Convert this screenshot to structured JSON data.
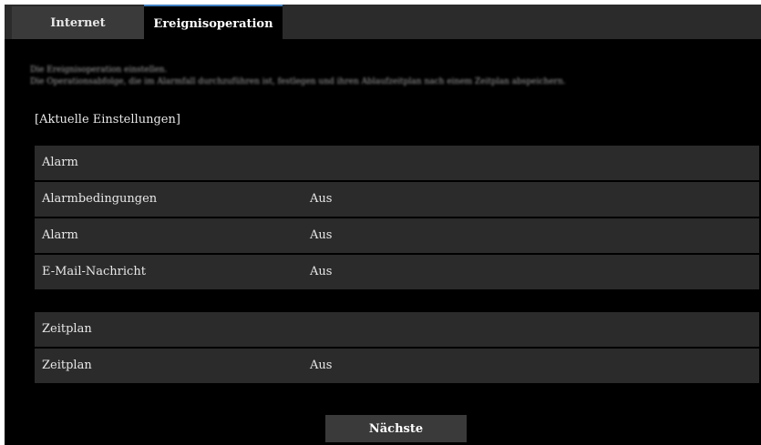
{
  "tabs": [
    {
      "label": "Internet"
    },
    {
      "label": "Ereignisoperation"
    }
  ],
  "description": {
    "line1": "Die Ereignisoperation einstellen.",
    "line2": "Die Operationsabfolge, die im Alarmfall durchzuführen ist, festlegen und ihren Ablaufzeitplan nach einem Zeitplan abspeichern."
  },
  "current_settings": {
    "heading": "[Aktuelle Einstellungen]",
    "alarm_section": {
      "title": "Alarm",
      "rows": [
        {
          "label": "Alarmbedingungen",
          "value": "Aus"
        },
        {
          "label": "Alarm",
          "value": "Aus"
        },
        {
          "label": "E-Mail-Nachricht",
          "value": "Aus"
        }
      ]
    },
    "schedule_section": {
      "title": "Zeitplan",
      "rows": [
        {
          "label": "Zeitplan",
          "value": "Aus"
        }
      ]
    }
  },
  "buttons": {
    "next_label": "Nächste"
  }
}
